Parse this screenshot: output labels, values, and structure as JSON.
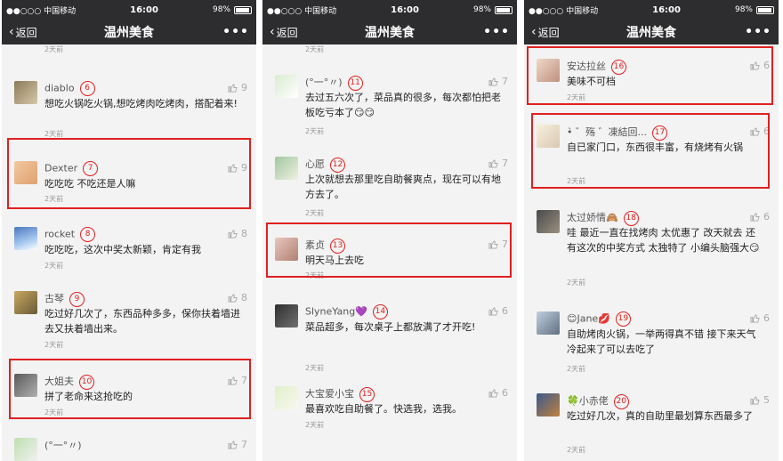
{
  "status_bar": {
    "carrier": "●●○○○ 中国移动",
    "time": "16:00",
    "battery": "98%"
  },
  "nav": {
    "back_label": "返回",
    "title": "温州美食",
    "more_label": "•••"
  },
  "panels": [
    {
      "top_date": "2天前",
      "comments": [
        {
          "name": "diablo",
          "num": "6",
          "likes": "9",
          "text": "想吃火锅吃火锅,想吃烤肉吃烤肉，搭配着来!",
          "date": "2天前"
        },
        {
          "name": "Dexter",
          "num": "7",
          "likes": "9",
          "text": "吃吃吃 不吃还是人嘛",
          "date": "2天前"
        },
        {
          "name": "rocket",
          "num": "8",
          "likes": "8",
          "text": "吃吃吃，这次中奖太新颖，肯定有我",
          "date": "2天前"
        },
        {
          "name": "古琴",
          "num": "9",
          "likes": "8",
          "text": "吃过好几次了，东西品种多多，保你扶着墙进去又扶着墙出来。",
          "date": "2天前"
        },
        {
          "name": "大姐夫",
          "num": "10",
          "likes": "7",
          "text": "拼了老命来这抢吃的",
          "date": "2天前"
        },
        {
          "name": "(°一°〃)",
          "num": "",
          "likes": "7",
          "text": "",
          "date": ""
        }
      ]
    },
    {
      "top_date": "2天前",
      "comments": [
        {
          "name": "(°一°〃)",
          "num": "11",
          "likes": "7",
          "text": "去过五六次了，菜品真的很多，每次都怕把老板吃亏本了😏😏",
          "date": "2天前"
        },
        {
          "name": "心愿",
          "num": "12",
          "likes": "7",
          "text": "上次就想去那里吃自助餐爽点，现在可以有地方去了。",
          "date": "2天前"
        },
        {
          "name": "素贞",
          "num": "13",
          "likes": "7",
          "text": "明天马上去吃",
          "date": "2天前"
        },
        {
          "name": "SlyneYang💜",
          "num": "14",
          "likes": "6",
          "text": "菜品超多，每次桌子上都放满了才开吃!",
          "date": "2天前"
        },
        {
          "name": "大宝爱小宝",
          "num": "15",
          "likes": "6",
          "text": "最喜欢吃自助餐了。快选我，选我。",
          "date": "2天前"
        }
      ]
    },
    {
      "top_date": "",
      "comments": [
        {
          "name": "安达拉丝",
          "num": "16",
          "likes": "6",
          "text": "美味不可档",
          "date": "2天前"
        },
        {
          "name": "•̀ ゛殇 ゛凍結回...",
          "num": "17",
          "likes": "6",
          "text": "自已家门口，东西很丰富，有烧烤有火锅",
          "date": "2天前"
        },
        {
          "name": "太过娇情🙈",
          "num": "18",
          "likes": "6",
          "text": "哇 最近一直在找烤肉 太优惠了 改天就去  还有这次的中奖方式 太独特了 小编头脑强大😏",
          "date": "2天前"
        },
        {
          "name": "😊Jane💋",
          "num": "19",
          "likes": "6",
          "text": "自助烤肉火锅，一举两得真不错 接下来天气冷起来了可以去吃了",
          "date": "2天前"
        },
        {
          "name": "🍀小赤佬",
          "num": "20",
          "likes": "5",
          "text": "吃过好几次，真的自助里最划算东西最多了",
          "date": "2天前"
        }
      ]
    }
  ],
  "colors": {
    "bar": "#2d2d2f",
    "panel_bg": "#f3f3f3",
    "highlight": "#e02020"
  }
}
